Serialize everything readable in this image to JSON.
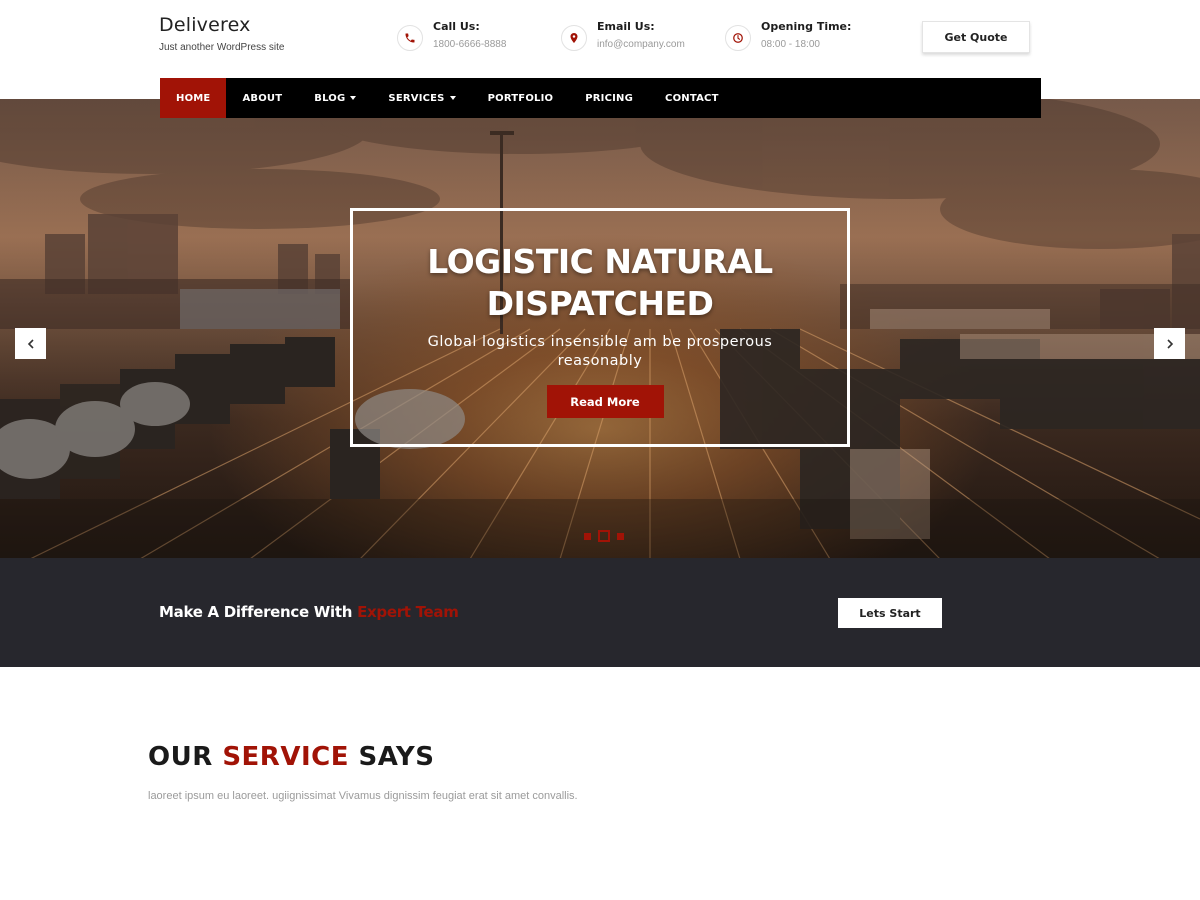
{
  "site": {
    "title": "Deliverex",
    "tagline": "Just another WordPress site"
  },
  "contacts": [
    {
      "label": "Call Us:",
      "value": "1800-6666-8888",
      "icon": "phone-icon"
    },
    {
      "label": "Email Us:",
      "value": "info@company.com",
      "icon": "location-pin-icon"
    },
    {
      "label": "Opening Time:",
      "value": "08:00 - 18:00",
      "icon": "clock-icon"
    }
  ],
  "header": {
    "quote_button": "Get Quote"
  },
  "nav": {
    "items": [
      {
        "label": "HOME",
        "active": true
      },
      {
        "label": "ABOUT"
      },
      {
        "label": "BLOG",
        "dropdown": true
      },
      {
        "label": "SERVICES",
        "dropdown": true
      },
      {
        "label": "PORTFOLIO"
      },
      {
        "label": "PRICING"
      },
      {
        "label": "CONTACT"
      }
    ]
  },
  "slider": {
    "title_line1": "LOGISTIC NATURAL",
    "title_line2": "DISPATCHED",
    "subtitle": "Global logistics insensible am be prosperous reasonably",
    "button": "Read More",
    "dots": 3,
    "active_dot": 2
  },
  "cta": {
    "text": "Make A Difference With",
    "highlight": "Expert Team",
    "button": "Lets Start"
  },
  "services": {
    "title_part1": "OUR",
    "title_highlight": "SERVICE",
    "title_part2": "SAYS",
    "description": "laoreet ipsum eu laoreet. ugiignissimat Vivamus dignissim feugiat erat sit amet convallis."
  },
  "colors": {
    "accent": "#a11306",
    "nav_bg": "#000000",
    "cta_bg": "#27272d"
  }
}
